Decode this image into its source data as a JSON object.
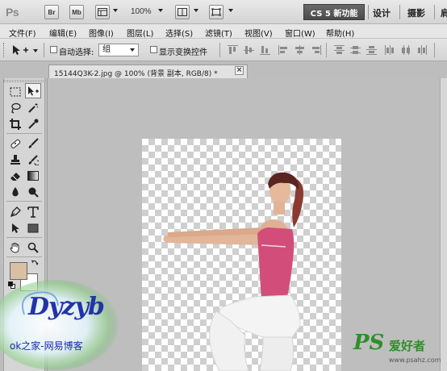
{
  "app": {
    "logo": "Ps",
    "bridge_label": "Br",
    "minibridge_label": "Mb",
    "zoom_level": "100%",
    "workspace_active": "CS 5 新功能",
    "workspaces": [
      "设计",
      "摄影",
      "肩"
    ]
  },
  "menu": {
    "items": [
      "文件(F)",
      "编辑(E)",
      "图像(I)",
      "图层(L)",
      "选择(S)",
      "滤镜(T)",
      "视图(V)",
      "窗口(W)",
      "帮助(H)"
    ]
  },
  "options": {
    "auto_select_label": "自动选择:",
    "auto_select_value": "组",
    "show_transform_label": "显示变换控件"
  },
  "document": {
    "tab_title": "15144Q3K-2.jpg @ 100% (背景 副本, RGB/8) *",
    "close_glyph": "×"
  },
  "tools": {
    "foreground_color": "#d9bfa3",
    "background_color": "#ffffff"
  },
  "watermarks": {
    "left_logo": "Dyzyb",
    "left_text": "ok之家-网易博客",
    "right_logo": "PS",
    "right_text": "爱好者",
    "right_url": "www.psahz.com"
  }
}
